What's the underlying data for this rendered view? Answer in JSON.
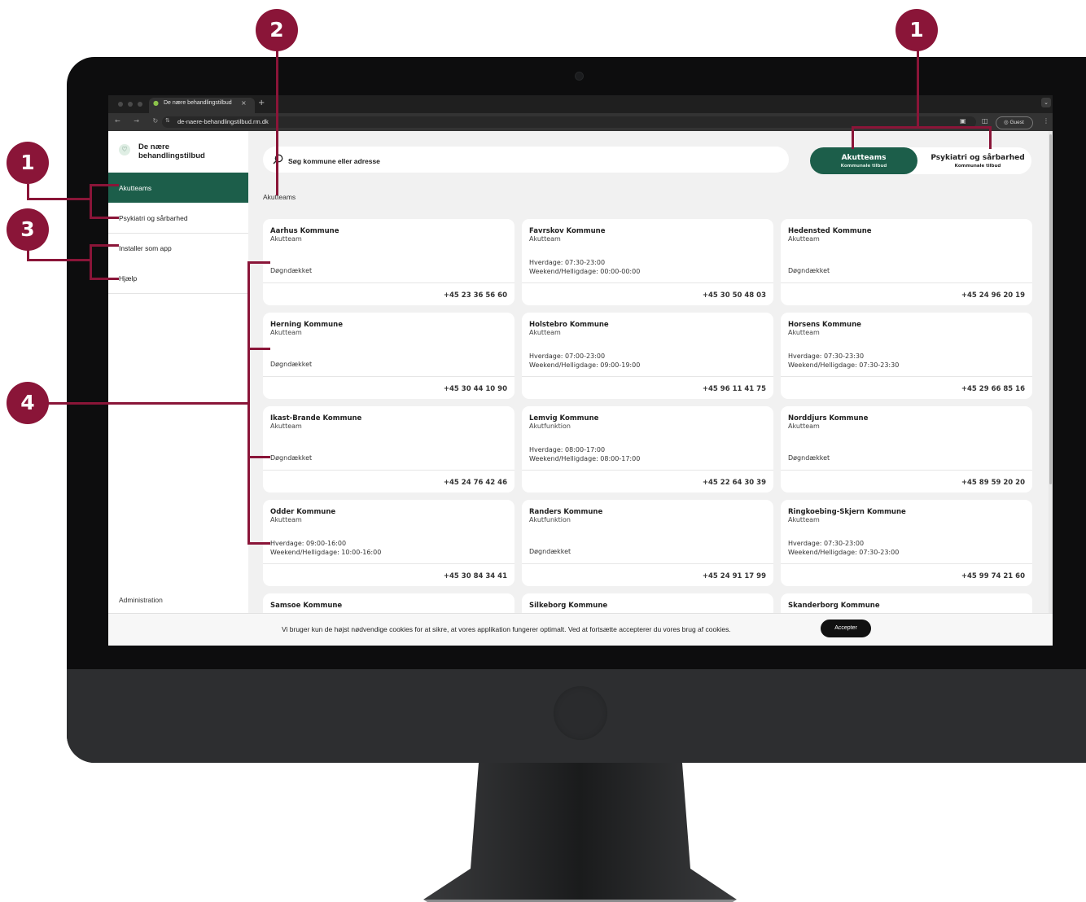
{
  "browser": {
    "tab_title": "De nære behandlingstilbud",
    "url": "de-naere-behandlingstilbud.rm.dk",
    "guest_label": "Guest"
  },
  "brand": {
    "name_line1": "De nære",
    "name_line2": "behandlingstilbud"
  },
  "sidebar": {
    "items": [
      {
        "label": "Akutteams"
      },
      {
        "label": "Psykiatri og sårbarhed"
      },
      {
        "label": "Installer som app"
      },
      {
        "label": "Hjælp"
      }
    ],
    "admin_label": "Administration"
  },
  "search": {
    "placeholder": "Søg kommune eller adresse"
  },
  "toggle": {
    "active_title": "Akutteams",
    "active_sub": "Kommunale tilbud",
    "inactive_title": "Psykiatri og sårbarhed",
    "inactive_sub": "Kommunale tilbud"
  },
  "section_title": "Akutteams",
  "cards": [
    {
      "name": "Aarhus Kommune",
      "type": "Akutteam",
      "always": "Døgndækket",
      "phone": "+45 23 36 56 60"
    },
    {
      "name": "Favrskov Kommune",
      "type": "Akutteam",
      "hours1": "Hverdage: 07:30-23:00",
      "hours2": "Weekend/Helligdage: 00:00-00:00",
      "phone": "+45 30 50 48 03"
    },
    {
      "name": "Hedensted Kommune",
      "type": "Akutteam",
      "always": "Døgndækket",
      "phone": "+45 24 96 20 19"
    },
    {
      "name": "Herning Kommune",
      "type": "Akutteam",
      "always": "Døgndækket",
      "phone": "+45 30 44 10 90"
    },
    {
      "name": "Holstebro Kommune",
      "type": "Akutteam",
      "hours1": "Hverdage: 07:00-23:00",
      "hours2": "Weekend/Helligdage: 09:00-19:00",
      "phone": "+45 96 11 41 75"
    },
    {
      "name": "Horsens Kommune",
      "type": "Akutteam",
      "hours1": "Hverdage: 07:30-23:30",
      "hours2": "Weekend/Helligdage: 07:30-23:30",
      "phone": "+45 29 66 85 16"
    },
    {
      "name": "Ikast-Brande Kommune",
      "type": "Akutteam",
      "always": "Døgndækket",
      "phone": "+45 24 76 42 46"
    },
    {
      "name": "Lemvig Kommune",
      "type": "Akutfunktion",
      "hours1": "Hverdage: 08:00-17:00",
      "hours2": "Weekend/Helligdage: 08:00-17:00",
      "phone": "+45 22 64 30 39"
    },
    {
      "name": "Norddjurs Kommune",
      "type": "Akutteam",
      "always": "Døgndækket",
      "phone": "+45 89 59 20 20"
    },
    {
      "name": "Odder Kommune",
      "type": "Akutteam",
      "hours1": "Hverdage: 09:00-16:00",
      "hours2": "Weekend/Helligdage: 10:00-16:00",
      "phone": "+45 30 84 34 41"
    },
    {
      "name": "Randers Kommune",
      "type": "Akutfunktion",
      "always": "Døgndækket",
      "phone": "+45 24 91 17 99"
    },
    {
      "name": "Ringkoebing-Skjern Kommune",
      "type": "Akutteam",
      "hours1": "Hverdage: 07:30-23:00",
      "hours2": "Weekend/Helligdage: 07:30-23:00",
      "phone": "+45 99 74 21 60"
    },
    {
      "name": "Samsoe Kommune"
    },
    {
      "name": "Silkeborg Kommune"
    },
    {
      "name": "Skanderborg Kommune"
    }
  ],
  "cookie": {
    "text": "Vi bruger kun de højst nødvendige cookies for at sikre, at vores applikation fungerer optimalt. Ved at fortsætte accepterer du vores brug af cookies.",
    "button": "Accepter"
  },
  "annotations": {
    "badge_toggle": "1",
    "badge_search": "2",
    "badge_nav": "1",
    "badge_install": "3",
    "badge_cards": "4"
  },
  "colors": {
    "accent_green": "#1c5e4a",
    "annotation": "#8a1538"
  }
}
